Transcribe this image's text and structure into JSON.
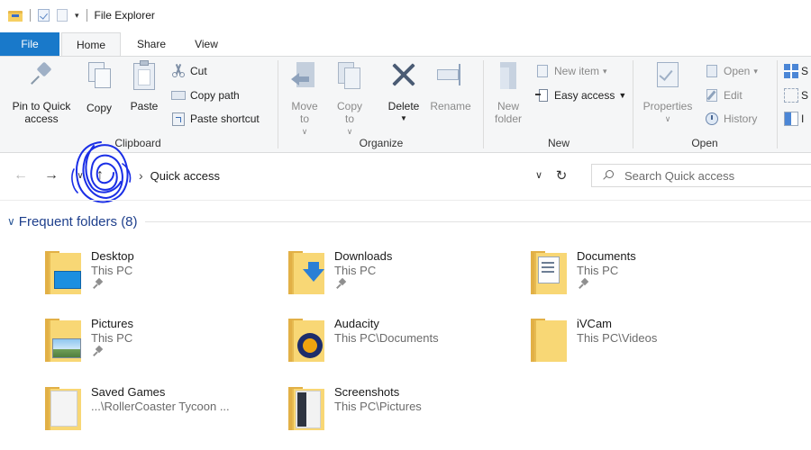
{
  "window": {
    "title": "File Explorer"
  },
  "ribbon_tabs": {
    "file": "File",
    "home": "Home",
    "share": "Share",
    "view": "View"
  },
  "clipboard": {
    "label": "Clipboard",
    "pin": "Pin to Quick access",
    "copy": "Copy",
    "paste": "Paste",
    "cut": "Cut",
    "copy_path": "Copy path",
    "paste_shortcut": "Paste shortcut"
  },
  "organize": {
    "label": "Organize",
    "move_to": "Move to",
    "copy_to": "Copy to",
    "delete": "Delete",
    "rename": "Rename"
  },
  "new": {
    "label": "New",
    "new_folder": "New folder",
    "new_item": "New item",
    "easy_access": "Easy access"
  },
  "open": {
    "label": "Open",
    "properties": "Properties",
    "open": "Open",
    "edit": "Edit",
    "history": "History"
  },
  "select": {
    "items": [
      "S",
      "S",
      "I"
    ]
  },
  "address": {
    "location": "Quick access",
    "search_placeholder": "Search Quick access"
  },
  "section": {
    "title": "Frequent folders (8)"
  },
  "folders": [
    {
      "name": "Desktop",
      "location": "This PC",
      "pinned": true,
      "icon": "desktop-folder-icon"
    },
    {
      "name": "Downloads",
      "location": "This PC",
      "pinned": true,
      "icon": "downloads-folder-icon"
    },
    {
      "name": "Documents",
      "location": "This PC",
      "pinned": true,
      "icon": "documents-folder-icon"
    },
    {
      "name": "Pictures",
      "location": "This PC",
      "pinned": true,
      "icon": "pictures-folder-icon"
    },
    {
      "name": "Audacity",
      "location": "This PC\\Documents",
      "pinned": false,
      "icon": "audacity-folder-icon"
    },
    {
      "name": "iVCam",
      "location": "This PC\\Videos",
      "pinned": false,
      "icon": "folder-icon"
    },
    {
      "name": "Saved Games",
      "location": "...\\RollerCoaster Tycoon ...",
      "pinned": false,
      "icon": "saved-games-folder-icon"
    },
    {
      "name": "Screenshots",
      "location": "This PC\\Pictures",
      "pinned": false,
      "icon": "screenshots-folder-icon"
    }
  ],
  "colors": {
    "file_tab": "#1979ca",
    "section_title": "#1e3f8c",
    "annotation_scribble": "#1a2ee6"
  }
}
